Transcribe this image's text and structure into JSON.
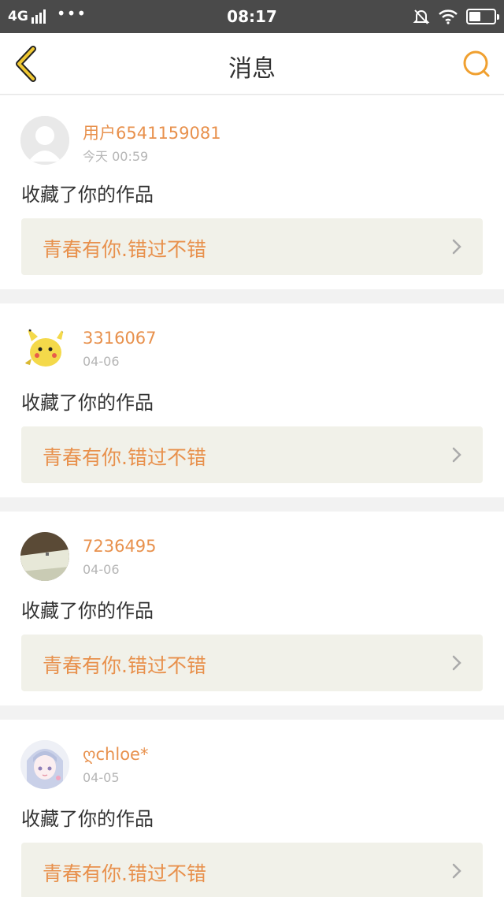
{
  "status_bar": {
    "network": "4G",
    "dots": "•••",
    "time": "08:17"
  },
  "nav": {
    "title": "消息",
    "back_icon": "chevron-left-icon",
    "search_icon": "search-icon",
    "accent_color": "#f0a030"
  },
  "colors": {
    "username": "#e8914d",
    "work_title": "#e8914d",
    "link_bg": "#f1f1e9"
  },
  "messages": [
    {
      "username": "用户6541159081",
      "date": "今天 00:59",
      "action": "收藏了你的作品",
      "work_title": "青春有你.错过不错",
      "avatar": "default-avatar"
    },
    {
      "username": "3316067",
      "date": "04-06",
      "action": "收藏了你的作品",
      "work_title": "青春有你.错过不错",
      "avatar": "pikachu-avatar"
    },
    {
      "username": "7236495",
      "date": "04-06",
      "action": "收藏了你的作品",
      "work_title": "青春有你.错过不错",
      "avatar": "photo-avatar"
    },
    {
      "username": "ღchloe*",
      "date": "04-05",
      "action": "收藏了你的作品",
      "work_title": "青春有你.错过不错",
      "avatar": "anime-girl-avatar"
    }
  ]
}
